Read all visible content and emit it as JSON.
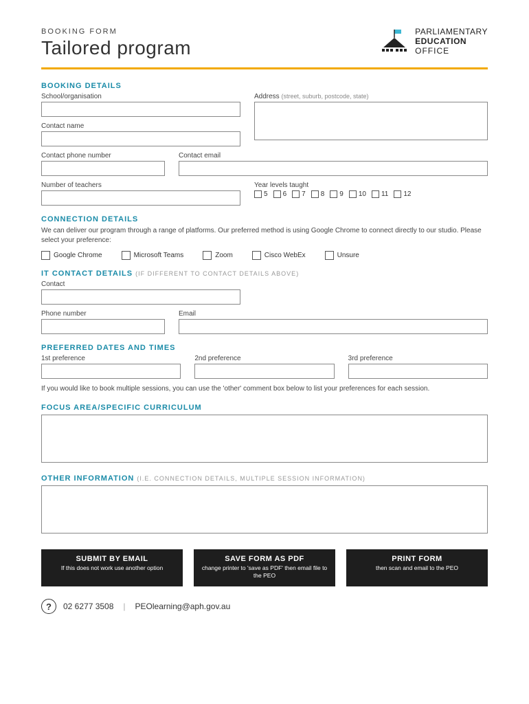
{
  "header": {
    "form_type": "BOOKING FORM",
    "title": "Tailored program",
    "logo": {
      "l1": "PARLIAMENTARY",
      "l2": "EDUCATION",
      "l3": "OFFICE"
    }
  },
  "booking_details": {
    "heading": "BOOKING DETAILS",
    "school_label": "School/organisation",
    "address_label": "Address",
    "address_hint": "(street, suburb, postcode, state)",
    "contact_name_label": "Contact name",
    "contact_phone_label": "Contact phone number",
    "contact_email_label": "Contact email",
    "num_teachers_label": "Number of teachers",
    "year_levels_label": "Year levels taught",
    "year_levels": [
      "5",
      "6",
      "7",
      "8",
      "9",
      "10",
      "11",
      "12"
    ]
  },
  "connection_details": {
    "heading": "CONNECTION DETAILS",
    "description": "We can deliver our program through a range of platforms. Our preferred method is using Google Chrome to connect directly to our studio. Please select your preference:",
    "options": [
      "Google Chrome",
      "Microsoft Teams",
      "Zoom",
      "Cisco WebEx",
      "Unsure"
    ]
  },
  "it_contact": {
    "heading": "IT CONTACT DETAILS",
    "sub": "(IF DIFFERENT TO CONTACT DETAILS ABOVE)",
    "contact_label": "Contact",
    "phone_label": "Phone number",
    "email_label": "Email"
  },
  "preferred_dates": {
    "heading": "PREFERRED DATES AND TIMES",
    "pref1_label": "1st preference",
    "pref2_label": "2nd preference",
    "pref3_label": "3rd preference",
    "note": "If you would like to book multiple sessions, you can use the 'other' comment box below to list your preferences for each session."
  },
  "focus_area": {
    "heading": "FOCUS AREA/SPECIFIC CURRICULUM"
  },
  "other_info": {
    "heading": "OTHER INFORMATION",
    "sub": "(I.E. CONNECTION DETAILS, MULTIPLE SESSION INFORMATION)"
  },
  "buttons": {
    "submit": {
      "title": "SUBMIT BY EMAIL",
      "sub": "If this does not work\nuse another option"
    },
    "save": {
      "title": "SAVE FORM AS PDF",
      "sub": "change printer to 'save as PDF'\nthen email file to the PEO"
    },
    "print": {
      "title": "PRINT FORM",
      "sub": "then scan and email to the PEO"
    }
  },
  "footer": {
    "phone": "02 6277 3508",
    "email": "PEOlearning@aph.gov.au"
  }
}
